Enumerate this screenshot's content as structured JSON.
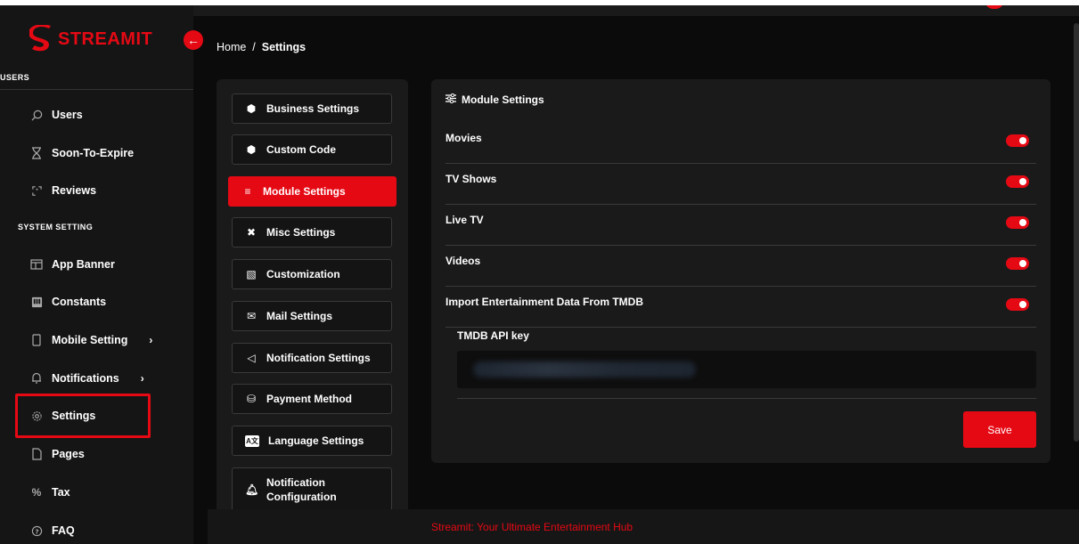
{
  "brand": {
    "name": "STREAMIT",
    "color": "#e50914"
  },
  "sidebar": {
    "users_heading": "USERS",
    "users_items": [
      {
        "label": "Users",
        "icon": "search-icon"
      },
      {
        "label": "Soon-To-Expire",
        "icon": "hourglass-icon"
      },
      {
        "label": "Reviews",
        "icon": "review-icon"
      }
    ],
    "system_heading": "SYSTEM SETTING",
    "system_items": [
      {
        "label": "App Banner",
        "icon": "banner-icon"
      },
      {
        "label": "Constants",
        "icon": "constants-icon"
      },
      {
        "label": "Mobile Setting",
        "icon": "mobile-icon"
      },
      {
        "label": "Notifications",
        "icon": "bell-icon"
      },
      {
        "label": "Settings",
        "icon": "gear-icon"
      },
      {
        "label": "Pages",
        "icon": "page-icon"
      },
      {
        "label": "Tax",
        "icon": "percent-icon"
      },
      {
        "label": "FAQ",
        "icon": "help-icon"
      }
    ]
  },
  "breadcrumb": {
    "home": "Home",
    "sep": "/",
    "current": "Settings"
  },
  "settings_menu": [
    {
      "label": "Business Settings",
      "icon": "cube-icon"
    },
    {
      "label": "Custom Code",
      "icon": "cube-icon"
    },
    {
      "label": "Module Settings",
      "icon": "list-icon",
      "active": true
    },
    {
      "label": "Misc Settings",
      "icon": "tools-icon"
    },
    {
      "label": "Customization",
      "icon": "palette-icon"
    },
    {
      "label": "Mail Settings",
      "icon": "mail-icon"
    },
    {
      "label": "Notification Settings",
      "icon": "megaphone-icon"
    },
    {
      "label": "Payment Method",
      "icon": "coins-icon"
    },
    {
      "label": "Language Settings",
      "icon": "language-icon"
    },
    {
      "label": "Notification Configuration",
      "icon": "bell-icon"
    }
  ],
  "module": {
    "title": "Module Settings",
    "rows": [
      {
        "label": "Movies",
        "enabled": true
      },
      {
        "label": "TV Shows",
        "enabled": true
      },
      {
        "label": "Live TV",
        "enabled": true
      },
      {
        "label": "Videos",
        "enabled": true
      },
      {
        "label": "Import Entertainment Data From TMDB",
        "enabled": true
      }
    ],
    "api_label": "TMDB API key",
    "save_label": "Save"
  },
  "footer": {
    "text": "Streamit: Your Ultimate Entertainment Hub"
  }
}
